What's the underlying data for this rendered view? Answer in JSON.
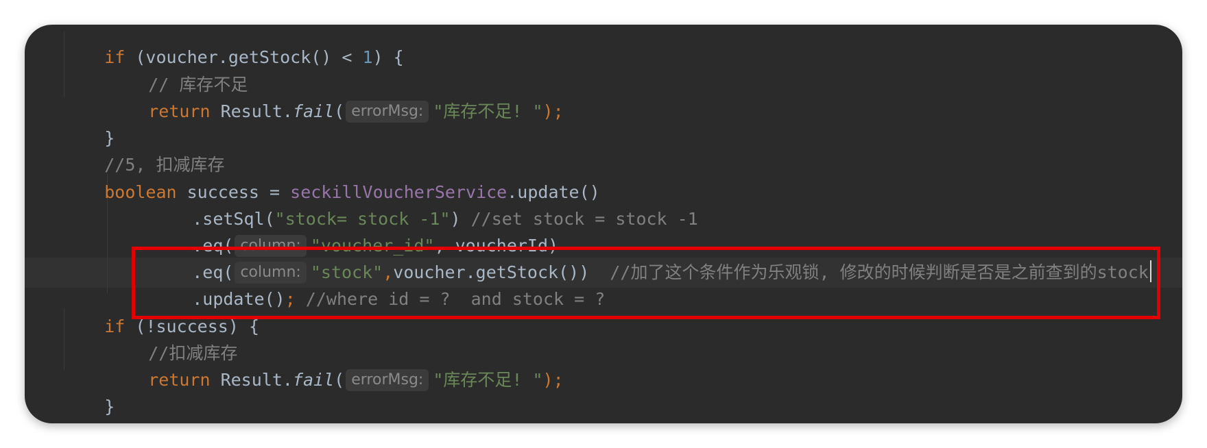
{
  "editor": {
    "lines": [
      {
        "if_kw": "if",
        "cond": " (voucher.getStock() < ",
        "one": "1",
        "close": ") {"
      },
      {
        "comment": "// 库存不足"
      },
      {
        "return_kw": "return",
        "call": " Result.",
        "fail": "fail",
        "open": "(",
        "hint": "errorMsg:",
        "str": "\"库存不足! \"",
        "end": ");"
      },
      {
        "brace": "}"
      },
      {
        "comment": "//5, 扣减库存"
      },
      {
        "bool_kw": "boolean",
        "mid": " success = ",
        "service": "seckillVoucherService",
        "tail": ".update()"
      },
      {
        "pre": ".setSql(",
        "str": "\"stock= stock -1\"",
        "close": ") ",
        "comment": "//set stock = stock -1"
      },
      {
        "pre": ".eq(",
        "hint": "column:",
        "str": "\"voucher_id\"",
        "rest": ", voucherId)"
      },
      {
        "pre": ".eq(",
        "hint": "column:",
        "str": "\"stock\"",
        "comma": ",",
        "rest": "voucher.getStock())",
        "comment": "//加了这个条件作为乐观锁, 修改的时候判断是否是之前查到的stock"
      },
      {
        "pre": ".update()",
        "semi": ";",
        "comment": " //where id = ?  and stock = ?"
      },
      {
        "if_kw": "if",
        "cond": " (!success) {"
      },
      {
        "comment": "//扣减库存"
      },
      {
        "return_kw": "return",
        "call": " Result.",
        "fail": "fail",
        "open": "(",
        "hint": "errorMsg:",
        "str": "\"库存不足! \"",
        "end": ");"
      },
      {
        "brace": "}"
      }
    ]
  },
  "annotation": {
    "color": "#e30000"
  }
}
